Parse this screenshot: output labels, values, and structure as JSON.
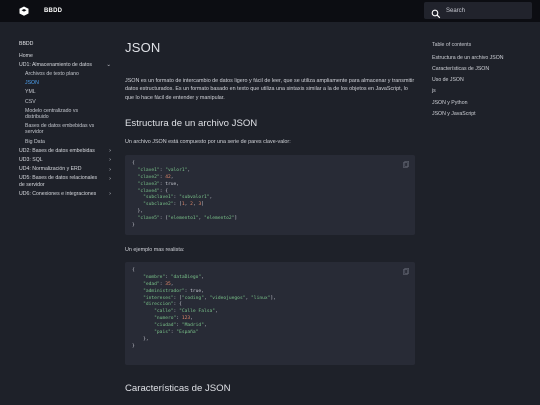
{
  "header": {
    "site_name": "BBDD",
    "search_placeholder": "Search"
  },
  "nav": {
    "title": "BBDD",
    "items": [
      {
        "label": "Home"
      },
      {
        "label": "UD1: Almacenamiento de datos",
        "expanded": true
      },
      {
        "label": "Archivos de texto plano"
      },
      {
        "label": "JSON",
        "active": true
      },
      {
        "label": "YML"
      },
      {
        "label": "CSV"
      },
      {
        "label": "Modelo centralizado vs distribuido"
      },
      {
        "label": "Bases de datos embebidas vs servidor"
      },
      {
        "label": "Big Data"
      },
      {
        "label": "UD2: Bases de datos embebidas"
      },
      {
        "label": "UD3: SQL"
      },
      {
        "label": "UD4: Normalización y ERD"
      },
      {
        "label": "UD5: Bases de datos relacionales de servidor"
      },
      {
        "label": "UD6: Conexiones e integraciones"
      }
    ]
  },
  "content": {
    "title": "JSON",
    "intro": "JSON es un formato de intercambio de datos ligero y fácil de leer, que se utiliza ampliamente para almacenar y transmitir datos estructurados. Es un formato basado en texto que utiliza una sintaxis similar a la de los objetos en JavaScript, lo que lo hace fácil de entender y manipular.",
    "section1_title": "Estructura de un archivo JSON",
    "section1_text": "Un archivo JSON está compuesto por una serie de pares clave-valor:",
    "example_label": "Un ejemplo mas realista:",
    "section2_title": "Características de JSON"
  },
  "toc": {
    "title": "Table of contents",
    "items": [
      "Estructura de un archivo JSON",
      "Características de JSON",
      "Uso de JSON",
      "js",
      "JSON y Python",
      "JSON y JavaScript"
    ]
  },
  "colors": {
    "accent": "#4ea3f2",
    "background": "#1e2129",
    "header": "#0c0d12",
    "code_bg": "#282b36"
  }
}
